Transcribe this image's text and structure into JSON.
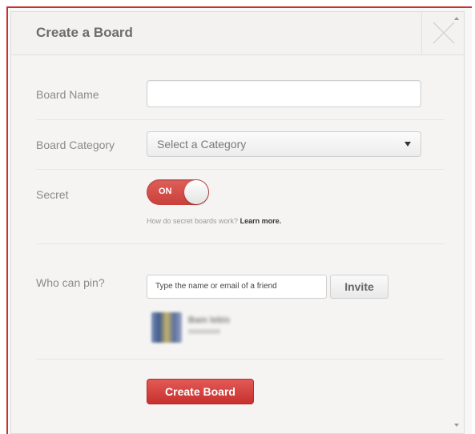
{
  "dialog": {
    "title": "Create a Board"
  },
  "form": {
    "board_name_label": "Board Name",
    "board_name_value": "",
    "board_category_label": "Board Category",
    "board_category_selected": "Select a Category",
    "secret_label": "Secret",
    "secret_toggle_text": "ON",
    "secret_help_text": "How do secret boards work?",
    "secret_help_link": "Learn more.",
    "who_can_pin_label": "Who can pin?",
    "invite_input_value": "Type the name or email of a friend",
    "invite_button": "Invite",
    "collaborator_name": "Bam lebis",
    "create_button": "Create Board"
  },
  "icons": {
    "close": "close-icon",
    "dropdown": "caret-down-icon"
  },
  "colors": {
    "accent_red": "#c9403a",
    "frame_red": "#c8332b"
  }
}
